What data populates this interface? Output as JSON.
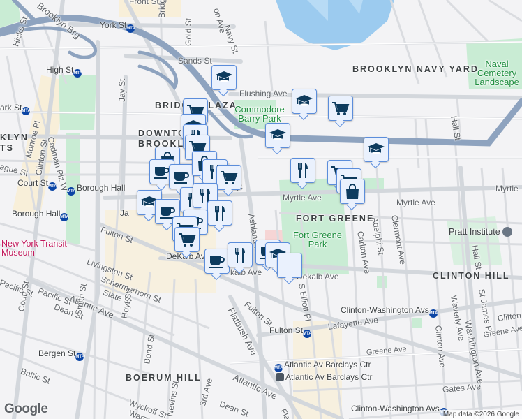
{
  "map": {
    "labels": {
      "front_st": "Front St",
      "brooklyn_brg": "Brooklyn Brg",
      "york_st": "York St",
      "gold_st": "Gold St",
      "sands_st": "Sands St",
      "high_st": "High St",
      "hicks_st": "Hicks St",
      "jay_st": "Jay St",
      "navy_st": "Navy St",
      "hudson_ave": "on Ave",
      "bridge_st": "Bridg",
      "flushing_ave": "Flushing Ave",
      "bridge_plaza": "BRIDGE PLAZA",
      "commodore_barry_park": "Commodore Barry Park",
      "navy_yard": "BROOKLYN NAVY YARD",
      "naval_cemetery": "Naval Cemetery Landscape",
      "park_st": "ark St",
      "downtown_brooklyn": "DOWNTOWN BROOKLYN",
      "heights": "KLYN TS",
      "cadman_plz_w": "Cadman Plz W",
      "monroe_pl": "Monroe Pl",
      "clinton_st": "Clinton St",
      "montague_st": "ague St",
      "court_st_stn": "Court St",
      "borough_hall_1": "Borough Hall",
      "borough_hall_2": "Borough Hall",
      "jay_st_stn": "Ja",
      "fulton_st_1": "Fulton St",
      "transit_museum": "New York Transit Museum",
      "livingston_st": "Livingston St",
      "dekalb_av_stn": "DeKalb Av",
      "schermerhorn_st": "Schermerhorn St",
      "state_st": "State St",
      "atlantic_ave_1": "Atlantic Ave",
      "pacific_st": "Pacific St",
      "pacific_st_2": "Pacific St",
      "dean_st_1": "Dean St",
      "court_st": "Court St",
      "smith_st": "Smith St",
      "hoyt_st": "Hoyt St",
      "bergen_st": "Bergen St",
      "baltic_st": "Baltic St",
      "boerum_hill": "BOERUM HILL",
      "bond_st": "Bond St",
      "wyckoff_st": "Wyckoff St",
      "warren_st": "Warren St",
      "nevins_st": "Nevins St",
      "third_ave": "3rd Ave",
      "dean_st_2": "Dean St",
      "flatbush_ave": "Flatbush Ave",
      "atlantic_ave_2": "Atlantic Ave",
      "flatbush_2": "Flat",
      "myrtle_ave_1": "Myrtle Ave",
      "myrtle_ave_2": "Myrtle Ave",
      "myrtle_ave_3": "Myrtle",
      "ashland_pl": "Ashland Pl",
      "fort_greene": "FORT GREENE",
      "fort_greene_park": "Fort Greene Park",
      "carlton_ave": "Carlton Ave",
      "adelphi_st": "Adelphi St",
      "clermont_ave": "Clermont Ave",
      "pratt_institute": "Pratt Institute",
      "hall_st_1": "Hall St",
      "hall_st_2": "Hall St",
      "clinton_hill": "CLINTON HILL",
      "dekalb_ave_1": "kalb Ave",
      "dekalb_ave_2": "Dekalb Ave",
      "s_elliott_pl": "S Elliott Pl",
      "fulton_st_2": "Fulton St",
      "clinton_washington_1": "Clinton-Washington Avs",
      "fulton_st_stn": "Fulton St",
      "lafayette_ave": "Lafayette Ave",
      "greene_ave_1": "Greene Ave",
      "greene_ave_2": "Greene Ave",
      "barclays_1": "Atlantic Av Barclays Ctr",
      "barclays_2": "Atlantic Av Barclays Ctr",
      "gates_ave": "Gates Ave",
      "clinton_washington_2": "Clinton-Washington Avs",
      "clinton_ave": "Clinton Ave",
      "waverly_ave": "Waverly Ave",
      "washington_ave": "Washington Ave",
      "st_james_pl": "St James Pl",
      "clifton": "Clifton",
      "cadman_plz_w_short": "Cadman Plz W",
      "navy_st_2": "avy St"
    },
    "subway_badge": "MTA",
    "markers": [
      "education-icon",
      "education-icon",
      "grocery-cart-icon",
      "education-icon",
      "education-icon",
      "grocery-cart-icon",
      "education-icon",
      "restaurant-icon",
      "grocery-cart-icon",
      "shopping-bag-icon",
      "cafe-icon",
      "cafe-icon",
      "shopping-bag-icon",
      "restaurant-icon",
      "grocery-cart-icon",
      "restaurant-icon",
      "grocery-cart-icon",
      "grocery-cart-icon",
      "shopping-bag-icon",
      "education-icon",
      "cafe-icon",
      "restaurant-icon",
      "restaurant-icon",
      "restaurant-icon",
      "cafe-icon",
      "grocery-cart-icon",
      "grocery-cart-icon",
      "cafe-icon",
      "restaurant-icon",
      "cafe-icon",
      "education-icon"
    ],
    "attribution": "Map data ©2026 Google",
    "logo": "Google",
    "colors": {
      "water": "#9ccbef",
      "park": "#c9ecd4",
      "highway": "#8ea3bf",
      "road": "#ffffff",
      "marker_border": "#5b8ddb",
      "marker_icon": "#0d3b5e"
    }
  }
}
